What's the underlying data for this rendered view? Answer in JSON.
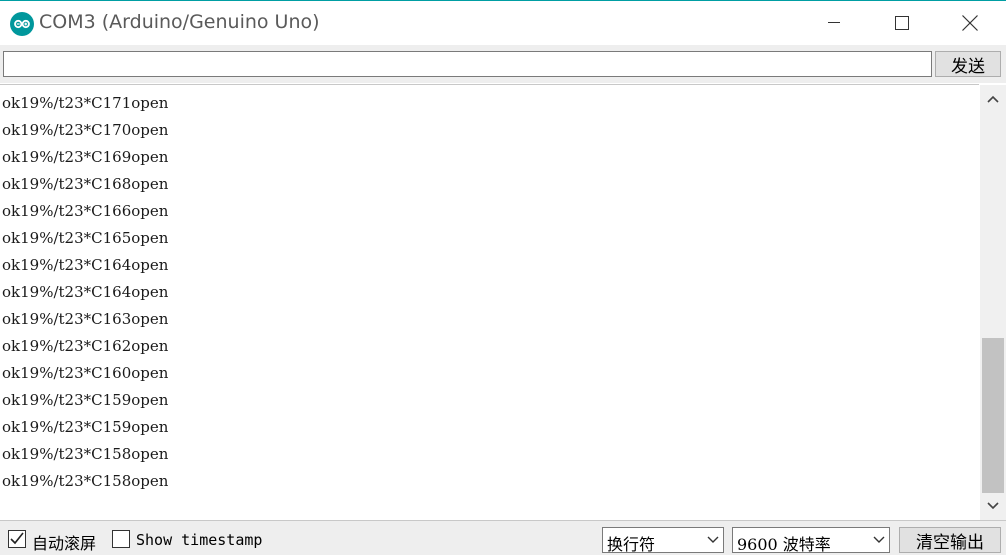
{
  "window": {
    "title": "COM3 (Arduino/Genuino Uno)"
  },
  "send": {
    "input_value": "",
    "button_label": "发送"
  },
  "output": {
    "lines": [
      "ok19%/t23*C171open",
      "ok19%/t23*C170open",
      "ok19%/t23*C169open",
      "ok19%/t23*C168open",
      "ok19%/t23*C166open",
      "ok19%/t23*C165open",
      "ok19%/t23*C164open",
      "ok19%/t23*C164open",
      "ok19%/t23*C163open",
      "ok19%/t23*C162open",
      "ok19%/t23*C160open",
      "ok19%/t23*C159open",
      "ok19%/t23*C159open",
      "ok19%/t23*C158open",
      "ok19%/t23*C158open"
    ]
  },
  "footer": {
    "autoscroll_label": "自动滚屏",
    "autoscroll_checked": true,
    "timestamp_label": "Show timestamp",
    "timestamp_checked": false,
    "line_ending": "换行符",
    "baud_rate": "9600 波特率",
    "clear_label": "清空输出"
  },
  "colors": {
    "accent": "#009ea3",
    "chrome_bg": "#eeeeee"
  }
}
